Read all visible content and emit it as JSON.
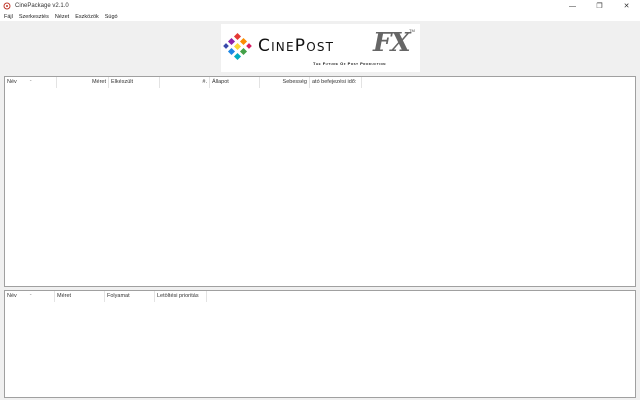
{
  "window": {
    "title": "CinePackage v2.1.0",
    "minimize_glyph": "—",
    "restore_glyph": "❐",
    "close_glyph": "✕"
  },
  "menu": [
    "Fájl",
    "Szerkesztés",
    "Nézet",
    "Eszközök",
    "Súgó"
  ],
  "logo": {
    "brand": "CinePost",
    "fx": "FX",
    "tm": "TM",
    "tagline": "The Future Of Post Production"
  },
  "download_list": {
    "columns": [
      "Név",
      "Méret",
      "Elkészült",
      "#.",
      "Állapot",
      "Sebesség",
      "ató befejezési idő:"
    ]
  },
  "files_list": {
    "columns": [
      "Név",
      "Méret",
      "Folyamat",
      "Letöltési prioritás"
    ]
  },
  "colors": {
    "window_bg": "#f0f0f0",
    "pane_bg": "#ffffff",
    "border": "#a0a0a0"
  }
}
